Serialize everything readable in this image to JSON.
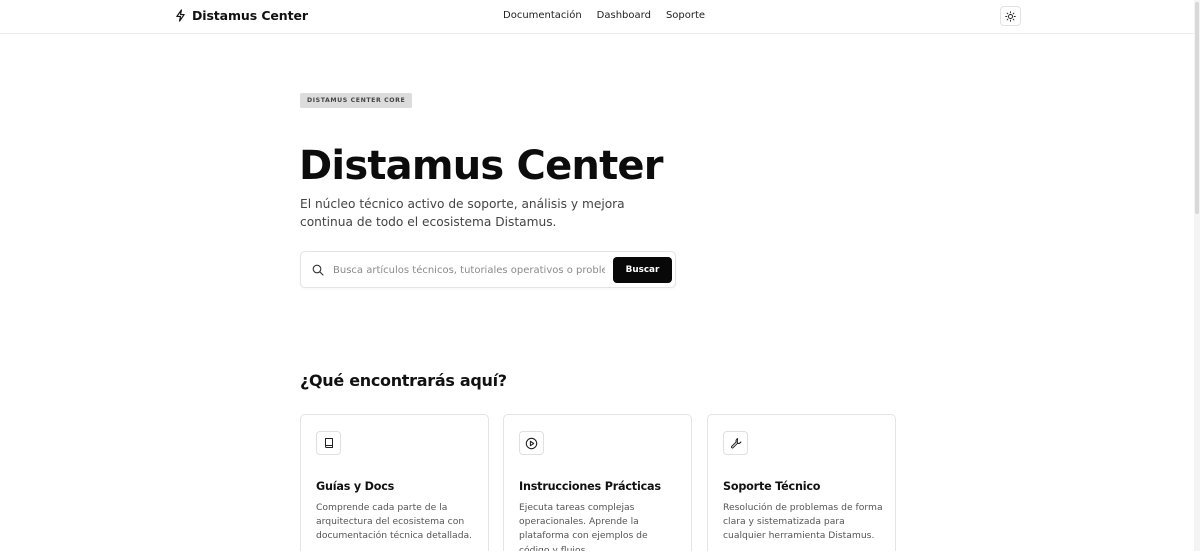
{
  "header": {
    "brand": {
      "name": "Distamus Center",
      "icon": "bolt-icon"
    },
    "nav": [
      "Documentación",
      "Dashboard",
      "Soporte"
    ],
    "theme_toggle": {
      "icon": "sun-icon"
    }
  },
  "hero": {
    "badge": "DISTAMUS CENTER CORE",
    "title": "Distamus Center",
    "subtitle": "El núcleo técnico activo de soporte, análisis y mejora continua de todo el ecosistema Distamus."
  },
  "search": {
    "icon": "search-icon",
    "placeholder": "Busca artículos técnicos, tutoriales operativos o problemas...",
    "value": "",
    "button_label": "Buscar"
  },
  "features": {
    "title": "¿Qué encontrarás aquí?",
    "cards": [
      {
        "icon": "book-icon",
        "title": "Guías y Docs",
        "description": "Comprende cada parte de la arquitectura del ecosistema con documentación técnica detallada."
      },
      {
        "icon": "play-circle-icon",
        "title": "Instrucciones Prácticas",
        "description": "Ejecuta tareas complejas operacionales. Aprende la plataforma con ejemplos de código y flujos."
      },
      {
        "icon": "wrench-icon",
        "title": "Soporte Técnico",
        "description": "Resolución de problemas de forma clara y sistematizada para cualquier herramienta Distamus."
      }
    ]
  },
  "colors": {
    "primary": "#080808",
    "badge_bg": "#dcdcdc",
    "border": "#e4e4e4",
    "muted_text": "#555555"
  }
}
